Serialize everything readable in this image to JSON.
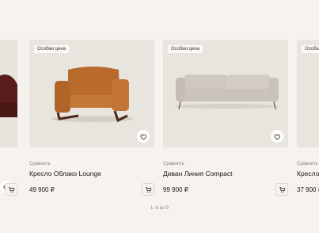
{
  "section": {
    "title_visible": "й"
  },
  "cards": [
    {
      "badge": "",
      "compare": "",
      "name": "",
      "price": ""
    },
    {
      "badge": "Особая цена",
      "compare": "Сравнить",
      "name": "Кресло Облако Lounge",
      "price": "49 900 ₽"
    },
    {
      "badge": "Особая цена",
      "compare": "Сравнить",
      "name": "Диван Линия Compact",
      "price": "99 900 ₽"
    },
    {
      "badge": "Особая цена",
      "compare": "Сравнить",
      "name": "Кресло",
      "price": "37 900 ₽"
    }
  ],
  "pagination": {
    "text": "1–4 из 9"
  },
  "colors": {
    "background": "#f6f3ee",
    "media": "#e7e3dd",
    "text": "#1d1a17",
    "muted": "#8a837b"
  },
  "icons": {
    "favorite": "heart-icon",
    "cart": "cart-icon"
  }
}
